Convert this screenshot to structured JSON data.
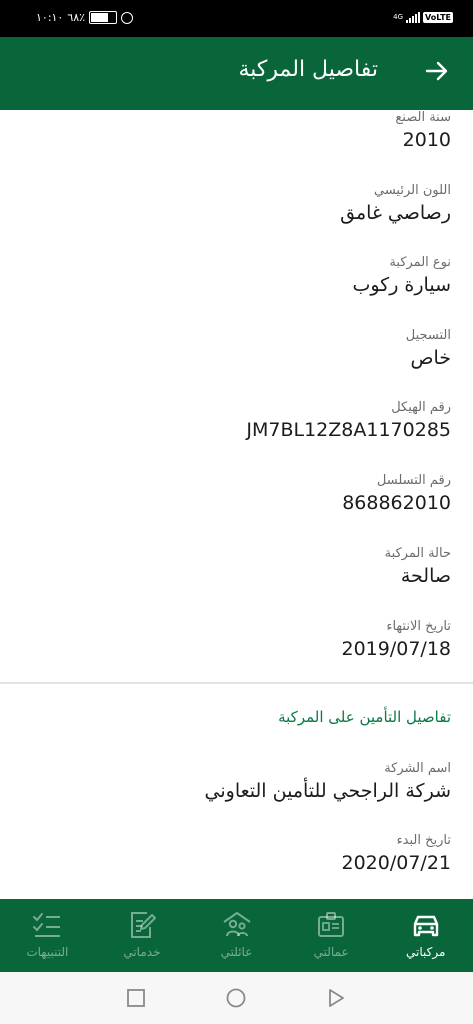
{
  "status_bar": {
    "time": "١٠:١٠",
    "battery": "٦٨٪",
    "network": "4G",
    "volte": "VoLTE"
  },
  "header": {
    "title": "تفاصيل المركبة"
  },
  "vehicle_fields": [
    {
      "label": "سنة الصنع",
      "value": "2010"
    },
    {
      "label": "اللون الرئيسي",
      "value": "رصاصي غامق"
    },
    {
      "label": "نوع المركبة",
      "value": "سيارة ركوب"
    },
    {
      "label": "التسجيل",
      "value": "خاص"
    },
    {
      "label": "رقم الهيكل",
      "value": "JM7BL12Z8A1170285"
    },
    {
      "label": "رقم التسلسل",
      "value": "868862010"
    },
    {
      "label": "حالة المركبة",
      "value": "صالحة"
    },
    {
      "label": "تاريخ الانتهاء",
      "value": "2019/07/18"
    }
  ],
  "insurance": {
    "title": "تفاصيل التأمين على المركبة",
    "fields": [
      {
        "label": "اسم الشركة",
        "value": "شركة الراجحي للتأمين التعاوني"
      },
      {
        "label": "تاريخ البدء",
        "value": "2020/07/21"
      }
    ]
  },
  "bottom_nav": {
    "items": [
      {
        "label": "مركباتي",
        "icon": "car-icon",
        "active": true
      },
      {
        "label": "عمالتي",
        "icon": "id-badge-icon",
        "active": false
      },
      {
        "label": "عائلتي",
        "icon": "family-icon",
        "active": false
      },
      {
        "label": "خدماتي",
        "icon": "edit-document-icon",
        "active": false
      },
      {
        "label": "التنبيهات",
        "icon": "checklist-icon",
        "active": false
      }
    ]
  },
  "colors": {
    "primary": "#09663a",
    "section_title": "#0a7a45",
    "label": "#6c6c6c",
    "value": "#1c1c1c"
  }
}
